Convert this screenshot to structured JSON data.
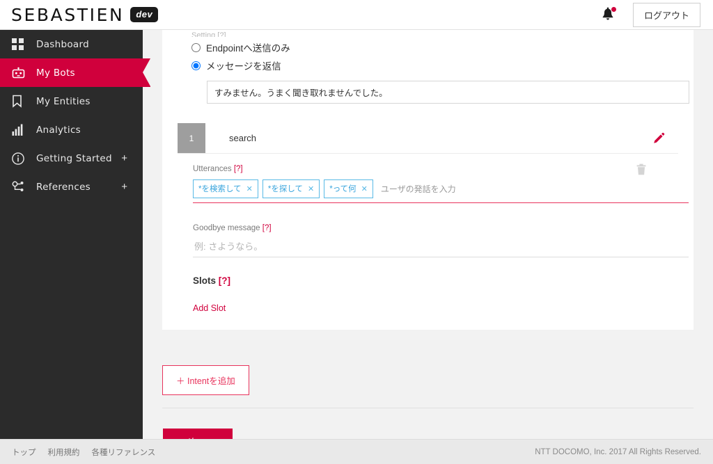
{
  "header": {
    "logo_text": "SEBASTIEN",
    "logo_badge": "dev",
    "bell_icon": "bell-icon",
    "logout_label": "ログアウト"
  },
  "sidebar": {
    "items": [
      {
        "label": "Dashboard",
        "icon": "grid-icon",
        "active": false,
        "expandable": false
      },
      {
        "label": "My Bots",
        "icon": "robot-icon",
        "active": true,
        "expandable": false
      },
      {
        "label": "My Entities",
        "icon": "bookmark-icon",
        "active": false,
        "expandable": false
      },
      {
        "label": "Analytics",
        "icon": "bar-chart-icon",
        "active": false,
        "expandable": false
      },
      {
        "label": "Getting Started",
        "icon": "info-icon",
        "active": false,
        "expandable": true,
        "expand_glyph": "+"
      },
      {
        "label": "References",
        "icon": "nodes-icon",
        "active": false,
        "expandable": true,
        "expand_glyph": "+"
      }
    ]
  },
  "main": {
    "setting_label": "Setting [?]",
    "radios": [
      {
        "label": "Endpointへ送信のみ",
        "checked": false
      },
      {
        "label": "メッセージを返信",
        "checked": true
      }
    ],
    "reply_value": "すみません。うまく聞き取れませんでした。",
    "intent": {
      "number": "1",
      "name": "search",
      "edit_icon": "pencil-icon",
      "delete_icon": "trash-icon",
      "utterances_label": "Utterances",
      "utterances_help": "[?]",
      "chips": [
        "*を検索して",
        "*を探して",
        "*って何"
      ],
      "chip_close_glyph": "✕",
      "utterance_placeholder": "ユーザの発話を入力",
      "goodbye_label": "Goodbye message",
      "goodbye_help": "[?]",
      "goodbye_placeholder": "例: さようなら。",
      "goodbye_value": "",
      "slots_label": "Slots",
      "slots_help": "[?]",
      "add_slot_label": "Add Slot"
    },
    "add_intent_label": "＋ Intentを追加",
    "next_label": "次へ"
  },
  "footer": {
    "links": [
      "トップ",
      "利用規約",
      "各種リファレンス"
    ],
    "copyright": "NTT DOCOMO, Inc. 2017 All Rights Reserved."
  },
  "colors": {
    "accent": "#d0003c",
    "accent_light": "#e8335c",
    "chip_blue": "#58b9e6",
    "sidebar_bg": "#2b2b2b",
    "page_bg": "#f2f2f2"
  }
}
